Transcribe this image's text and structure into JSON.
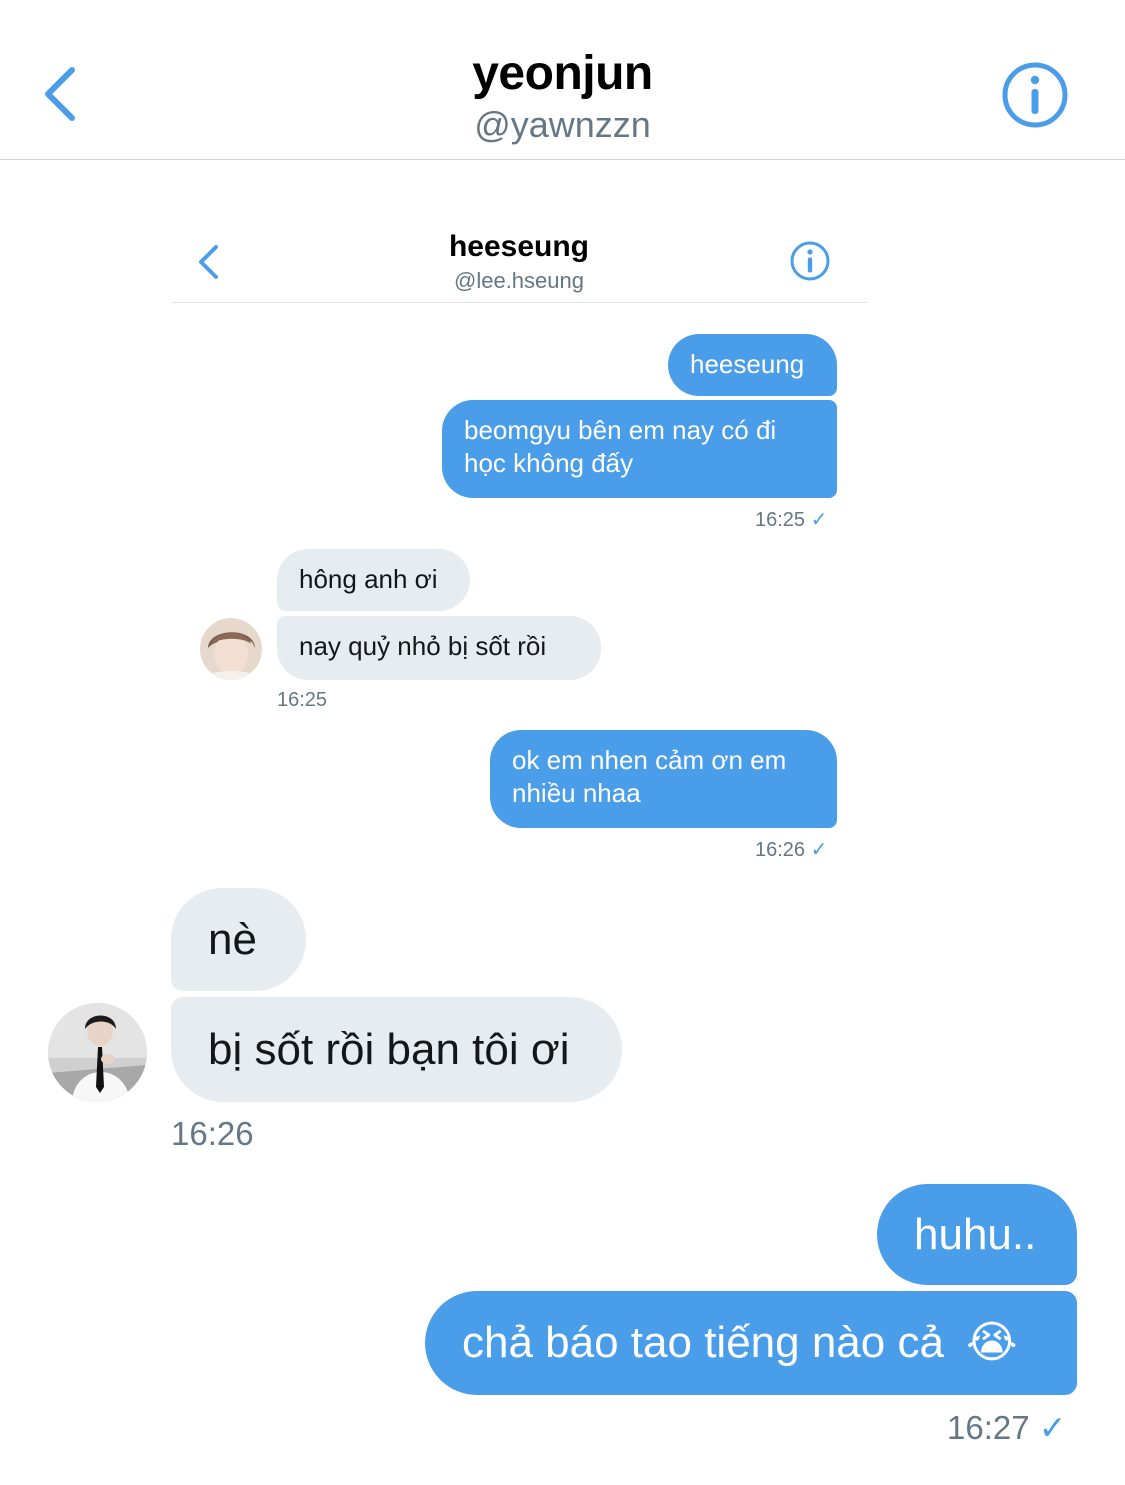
{
  "header": {
    "title": "yeonjun",
    "handle": "@yawnzzn",
    "back_icon": "chevron-left-icon",
    "info_icon": "info-circle-icon"
  },
  "embedded": {
    "header": {
      "title": "heeseung",
      "handle": "@lee.hseung"
    },
    "messages": {
      "m1": "heeseung",
      "m2_line1": "beomgyu bên em nay có đi",
      "m2_line2": "học không đấy",
      "t1": "16:25",
      "m3": "hông anh ơi",
      "m4": "nay quỷ nhỏ bị sốt rồi",
      "t2": "16:25",
      "m5_line1": "ok em nhen cảm ơn em",
      "m5_line2": "nhiều nhaa",
      "t3": "16:26"
    }
  },
  "conversation": {
    "m1": "nè",
    "m2": "bị sốt rồi bạn tôi ơi",
    "t1": "16:26",
    "m3": "huhu..",
    "m4": "chả báo tao tiếng nào cả",
    "m4_emoji": "😭",
    "t2": "16:27"
  },
  "read_mark": "✓",
  "colors": {
    "accent": "#4a9de8",
    "received_bubble": "#e6ecf0",
    "muted_text": "#657786"
  }
}
